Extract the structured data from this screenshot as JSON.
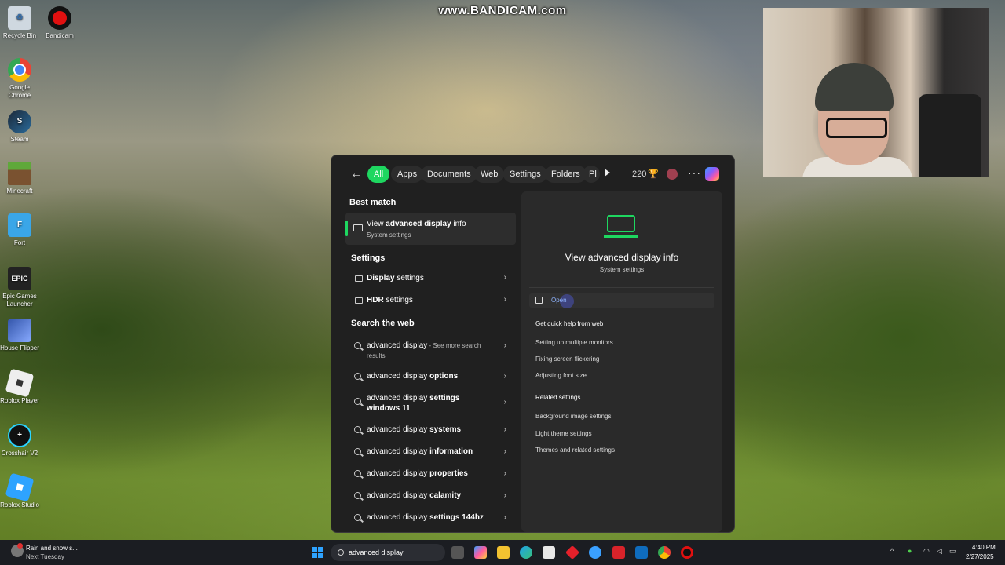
{
  "watermark": "www.BANDICAM.com",
  "desktop_icons": [
    {
      "label": "Recycle Bin",
      "icon": "recycle-bin-icon"
    },
    {
      "label": "Bandicam",
      "icon": "bandicam-icon"
    },
    {
      "label": "Google Chrome",
      "icon": "chrome-icon"
    },
    {
      "label": "Steam",
      "icon": "steam-icon"
    },
    {
      "label": "Minecraft",
      "icon": "minecraft-icon"
    },
    {
      "label": "Fort",
      "icon": "fortnite-icon"
    },
    {
      "label": "Epic Games Launcher",
      "icon": "epic-games-icon"
    },
    {
      "label": "House Flipper",
      "icon": "house-flipper-icon"
    },
    {
      "label": "Roblox Player",
      "icon": "roblox-icon"
    },
    {
      "label": "Crosshair V2",
      "icon": "crosshair-icon"
    },
    {
      "label": "Roblox Studio",
      "icon": "roblox-studio-icon"
    }
  ],
  "search_panel": {
    "filters": [
      "All",
      "Apps",
      "Documents",
      "Web",
      "Settings",
      "Folders",
      "Pl"
    ],
    "points": "220",
    "best_match_heading": "Best match",
    "best_match": {
      "title_pre": "View ",
      "title_bold": "advanced display",
      "title_post": " info",
      "subtitle": "System settings"
    },
    "settings_heading": "Settings",
    "settings_items": [
      {
        "bold": "Display",
        "rest": " settings"
      },
      {
        "bold": "HDR",
        "rest": " settings"
      }
    ],
    "web_heading": "Search the web",
    "web_items": [
      {
        "text": "advanced display",
        "bold": "",
        "sub": " - See more search results"
      },
      {
        "text": "advanced display ",
        "bold": "options",
        "sub": ""
      },
      {
        "text": "advanced display ",
        "bold": "settings windows 11",
        "sub": ""
      },
      {
        "text": "advanced display ",
        "bold": "systems",
        "sub": ""
      },
      {
        "text": "advanced display ",
        "bold": "information",
        "sub": ""
      },
      {
        "text": "advanced display ",
        "bold": "properties",
        "sub": ""
      },
      {
        "text": "advanced display ",
        "bold": "calamity",
        "sub": ""
      },
      {
        "text": "advanced display ",
        "bold": "settings 144hz",
        "sub": ""
      }
    ],
    "detail": {
      "title": "View advanced display info",
      "subtitle": "System settings",
      "open_label": "Open",
      "web_help_heading": "Get quick help from web",
      "web_help_links": [
        "Setting up multiple monitors",
        "Fixing screen flickering",
        "Adjusting font size"
      ],
      "related_heading": "Related settings",
      "related_links": [
        "Background image settings",
        "Light theme settings",
        "Themes and related settings"
      ]
    }
  },
  "taskbar": {
    "weather_line1": "Rain and snow s...",
    "weather_line2": "Next Tuesday",
    "search_value": "advanced display",
    "time": "4:40 PM",
    "date": "2/27/2025"
  },
  "colors": {
    "accent": "#1ed760",
    "panel_bg": "#202020",
    "taskbar_bg": "#1b1d22"
  }
}
